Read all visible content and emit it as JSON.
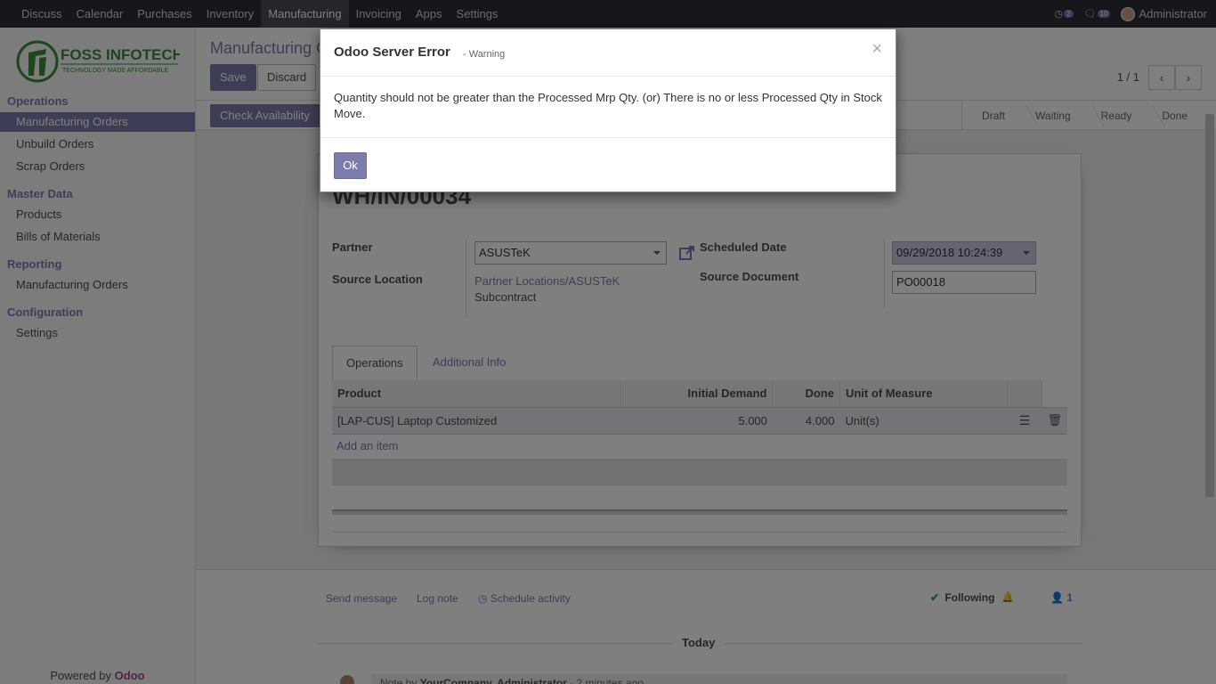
{
  "navbar": {
    "menu": [
      "Discuss",
      "Calendar",
      "Purchases",
      "Inventory",
      "Manufacturing",
      "Invoicing",
      "Apps",
      "Settings"
    ],
    "active_index": 4,
    "activity_count": "2",
    "message_count": "10",
    "user": "Administrator"
  },
  "sidebar": {
    "logo_name": "FOSS INFOTECH",
    "logo_tagline": "TECHNOLOGY MADE AFFORDABLE",
    "sections": [
      {
        "title": "Operations",
        "items": [
          "Manufacturing Orders",
          "Unbuild Orders",
          "Scrap Orders"
        ]
      },
      {
        "title": "Master Data",
        "items": [
          "Products",
          "Bills of Materials"
        ]
      },
      {
        "title": "Reporting",
        "items": [
          "Manufacturing Orders"
        ]
      },
      {
        "title": "Configuration",
        "items": [
          "Settings"
        ]
      }
    ],
    "powered_prefix": "Powered by",
    "powered_brand": "Odoo"
  },
  "control_panel": {
    "breadcrumb": "Manufacturing O",
    "save": "Save",
    "discard": "Discard",
    "pager": "1 / 1"
  },
  "statusbar": {
    "check_availability": "Check Availability",
    "stages": [
      "Draft",
      "Waiting",
      "Ready",
      "Done"
    ]
  },
  "form": {
    "name": "WH/IN/00034",
    "partner_label": "Partner",
    "partner_value": "ASUSTeK",
    "source_location_label": "Source Location",
    "source_location_value": "Partner Locations/ASUSTeK",
    "source_location_sub": "Subcontract",
    "scheduled_date_label": "Scheduled Date",
    "scheduled_date_value": "09/29/2018 10:24:39",
    "source_document_label": "Source Document",
    "source_document_value": "PO00018",
    "tabs": [
      "Operations",
      "Additional Info"
    ],
    "table": {
      "headers": [
        "Product",
        "Initial Demand",
        "Done",
        "Unit of Measure"
      ],
      "rows": [
        {
          "product": "[LAP-CUS] Laptop Customized",
          "initial_demand": "5.000",
          "done": "4.000",
          "uom": "Unit(s)"
        }
      ],
      "add_item": "Add an item"
    }
  },
  "chatter": {
    "send_message": "Send message",
    "log_note": "Log note",
    "schedule_activity": "Schedule activity",
    "following": "Following",
    "followers": "1",
    "today": "Today",
    "note_prefix": "Note by",
    "note_author": "YourCompany, Administrator",
    "note_time": "- 2 minutes ago"
  },
  "dialog": {
    "title": "Odoo Server Error",
    "subtitle": "- Warning",
    "message": "Quantity should not be greater than the Processed Mrp Qty. (or) There is no or less Processed Qty in Stock Move.",
    "ok": "Ok",
    "close": "×"
  },
  "colors": {
    "brand": "#7c7bad",
    "navbar": "#2c2c36",
    "logo_green": "#3c8a3c"
  }
}
